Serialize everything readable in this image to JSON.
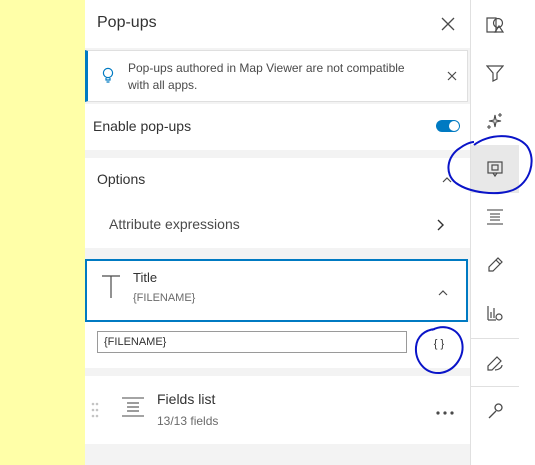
{
  "panel": {
    "title": "Pop-ups",
    "close_icon": "close-icon"
  },
  "notice": {
    "text": "Pop-ups authored in Map Viewer are not compatible with all apps.",
    "icon": "lightbulb-icon",
    "accent_color": "#007ac2"
  },
  "enable": {
    "label": "Enable pop-ups",
    "checked": true
  },
  "options": {
    "label": "Options",
    "expanded": true,
    "items": [
      {
        "label": "Attribute expressions"
      }
    ]
  },
  "title_card": {
    "label": "Title",
    "value": "{FILENAME}",
    "input_value": "{FILENAME}",
    "expression_button": "{ }"
  },
  "fields_list": {
    "label": "Fields list",
    "count": "13/13 fields",
    "more_icon": "more-icon"
  },
  "toolbar": {
    "tools": [
      {
        "name": "properties-icon",
        "active": false
      },
      {
        "name": "filter-icon",
        "active": false
      },
      {
        "name": "effects-icon",
        "active": false
      },
      {
        "name": "popups-icon",
        "active": true
      },
      {
        "name": "fields-icon",
        "active": false
      },
      {
        "name": "edit-icon",
        "active": false
      },
      {
        "name": "charts-icon",
        "active": false
      },
      {
        "name": "sketch-icon",
        "active": false
      },
      {
        "name": "configure-icon",
        "active": false
      }
    ]
  },
  "colors": {
    "brand_blue": "#007ac2",
    "annotation_ink": "#0a14c8",
    "map_background": "#ffffa8"
  }
}
